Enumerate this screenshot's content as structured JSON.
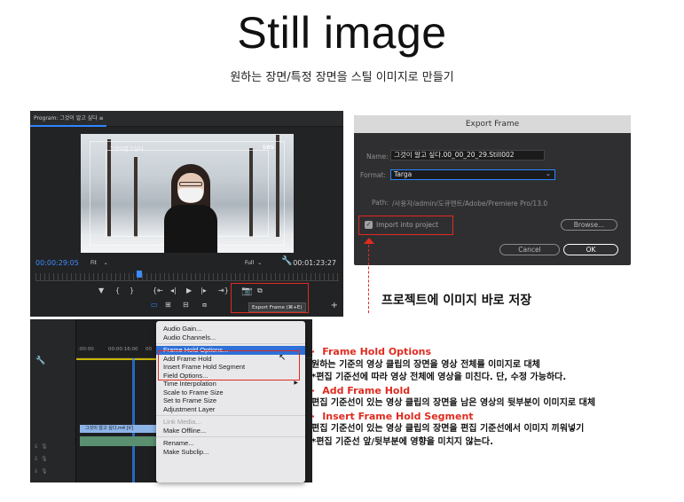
{
  "page": {
    "title": "Still image",
    "subtitle": "원하는 장면/특정 장면을 스틸 이미지로 만들기"
  },
  "program_monitor": {
    "panel_title": "Program: 그것이 알고 싶다  ≡",
    "watermark_left": "그것이알고싶다",
    "watermark_right": "SBS",
    "timecode_current": "00:00:29:05",
    "fit_label": "Fit",
    "full_label": "Full",
    "timecode_duration": "00:01:23:27",
    "tooltip": "Export Frame (⌘+E)"
  },
  "export_frame": {
    "title": "Export Frame",
    "name_label": "Name:",
    "name_value": "그것이 알고 싶다.00_00_20_29.Still002",
    "format_label": "Format:",
    "format_value": "Targa",
    "path_label": "Path:",
    "path_value": "/사용자/admin/도큐멘트/Adobe/Premiere Pro/13.0",
    "import_label": "Import into project",
    "import_checked": true,
    "browse_label": "Browse...",
    "cancel_label": "Cancel",
    "ok_label": "OK"
  },
  "save_note": "프로젝트에 이미지 바로 저장",
  "timeline": {
    "time_a": ":00:00",
    "time_b": "00:00:16:00",
    "time_c": "00",
    "clip_label": "그것이 알고 싶다.m4 [V]"
  },
  "context_menu": {
    "items": [
      {
        "label": "Audio Gain...",
        "state": "normal"
      },
      {
        "label": "Audio Channels...",
        "state": "normal"
      },
      {
        "label": "Frame Hold Options...",
        "state": "selected"
      },
      {
        "label": "Add Frame Hold",
        "state": "normal"
      },
      {
        "label": "Insert Frame Hold Segment",
        "state": "normal"
      },
      {
        "label": "Field Options...",
        "state": "normal"
      },
      {
        "label": "Time Interpolation",
        "state": "submenu"
      },
      {
        "label": "Scale to Frame Size",
        "state": "normal"
      },
      {
        "label": "Set to Frame Size",
        "state": "normal"
      },
      {
        "label": "Adjustment Layer",
        "state": "normal"
      },
      {
        "label": "Link Media...",
        "state": "disabled"
      },
      {
        "label": "Make Offline...",
        "state": "normal"
      },
      {
        "label": "Rename...",
        "state": "normal"
      },
      {
        "label": "Make Subclip...",
        "state": "normal"
      }
    ]
  },
  "notes": {
    "h1": "Frame Hold Options",
    "l1": "원하는 기준의 영상 클립의 장면을 영상 전체를 이미지로 대체",
    "l2": "*편집 기준선에 따라 영상 전체에 영상을 미친다. 단, 수정 가능하다.",
    "h2": "Add Frame Hold",
    "l3": "편집 기준선이 있는 영상 클립의 장면을 남은 영상의 뒷부분이 이미지로 대체",
    "h3": "Insert Frame Hold Segment",
    "l4": "편집 기준선이 있는 영상 클립의 장면을 편집 기준선에서 이미지 끼워넣기",
    "l5": "*편집 기준선 앞/뒷부분에 영향을 미치지 않는다.",
    "bullet": "·"
  },
  "colors": {
    "highlight_red": "#e02b20",
    "premiere_blue": "#2d86ff",
    "menu_selected": "#2f6fd6"
  }
}
